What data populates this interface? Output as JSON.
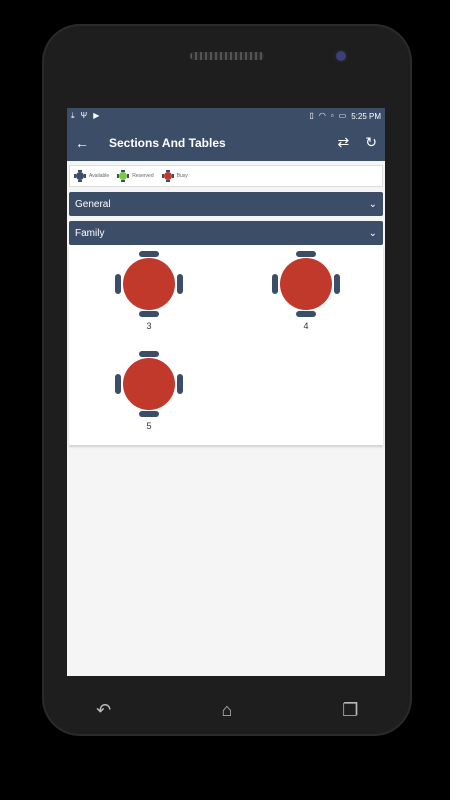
{
  "status_bar": {
    "time": "5:25 PM",
    "left_icons": [
      "download-icon",
      "usb-icon",
      "play-icon"
    ],
    "right_icons": [
      "vibrate-icon",
      "wifi-icon",
      "sim-icon",
      "battery-icon"
    ]
  },
  "app_bar": {
    "title": "Sections And Tables",
    "back_icon": "arrow-back-icon",
    "actions": [
      "swap-icon",
      "refresh-icon"
    ]
  },
  "legend": [
    {
      "label": "Available",
      "color": "#3c4d68"
    },
    {
      "label": "Reserved",
      "color": "#7ac943"
    },
    {
      "label": "Busy",
      "color": "#c0392b"
    }
  ],
  "sections": [
    {
      "name": "General",
      "expanded": false
    },
    {
      "name": "Family",
      "expanded": true,
      "tables": [
        {
          "number": "3",
          "status": "Busy"
        },
        {
          "number": "4",
          "status": "Busy"
        },
        {
          "number": "5",
          "status": "Busy"
        }
      ]
    }
  ],
  "nav": [
    "back-icon",
    "home-icon",
    "recents-icon"
  ],
  "colors": {
    "primary": "#3c4d68",
    "busy": "#c0392b",
    "reserved": "#7ac943"
  }
}
